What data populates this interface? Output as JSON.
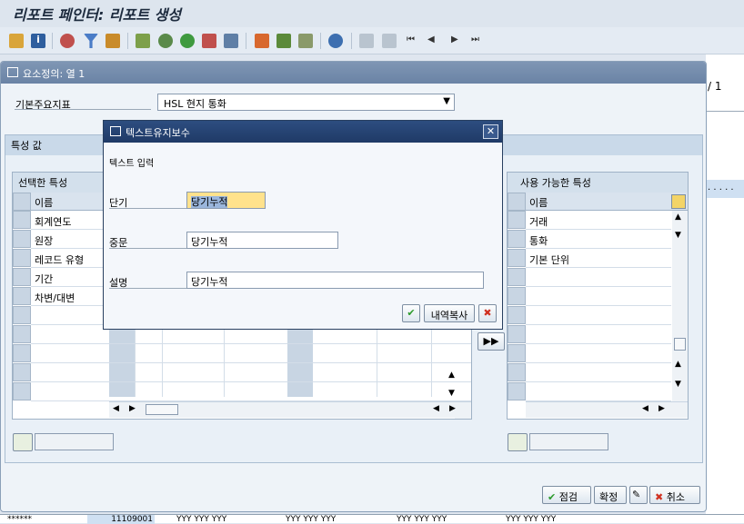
{
  "window": {
    "title": "리포트 페인터: 리포트 생성"
  },
  "main_dialog": {
    "title": "요소정의: 열 1",
    "key_figure_label": "기본주요지표",
    "key_figure_value": "HSL 현지 통화",
    "char_values_label": "특성 값",
    "selected": {
      "header": "선택한 특성",
      "col_name": "이름",
      "rows": [
        "회계연도",
        "원장",
        "레코드 유형",
        "기간",
        "차변/대변"
      ]
    },
    "available": {
      "header": "사용 가능한 특성",
      "col_name": "이름",
      "rows": [
        "거래",
        "통화",
        "기본 단위"
      ]
    },
    "buttons": {
      "check": "점검",
      "confirm": "확정",
      "cancel": "취소"
    }
  },
  "popup": {
    "title": "텍스트유지보수",
    "section": "텍스트 입력",
    "short_label": "단기",
    "short_value": "당기누적",
    "medium_label": "중문",
    "medium_value": "당기누적",
    "desc_label": "설명",
    "desc_value": "당기누적",
    "copy_button": "내역복사"
  },
  "background": {
    "page_text": "/ 1",
    "dots": ". . . . .",
    "bottom_cells": [
      "******",
      "11109001",
      "YYY YYY YYY",
      "YYY YYY YYY",
      "YYY YYY YYY",
      "YYY YYY YYY"
    ]
  },
  "colors": {
    "popup_header": "#1f3a66",
    "dialog_header": "#6a83a5",
    "highlight": "#ffe28c"
  }
}
